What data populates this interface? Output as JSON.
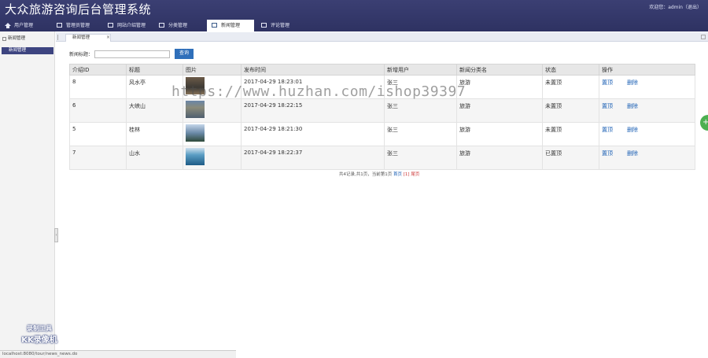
{
  "app": {
    "title": "大众旅游咨询后台管理系统",
    "user_info": "欢迎您：admin（退出）"
  },
  "nav": {
    "tabs": [
      {
        "label": "用户管理"
      },
      {
        "label": "管理员管理"
      },
      {
        "label": "网站介绍管理"
      },
      {
        "label": "分类管理"
      },
      {
        "label": "新闻管理"
      },
      {
        "label": "评论管理"
      }
    ],
    "active_index": 4
  },
  "sidebar": {
    "section_title": "新闻管理",
    "items": [
      {
        "label": "新闻管理"
      }
    ]
  },
  "tabbar": {
    "active_tab": "新闻管理",
    "close_glyph": "×"
  },
  "search": {
    "label": "新闻标题：",
    "value": "",
    "button_label": "查询"
  },
  "table": {
    "headers": [
      "介绍ID",
      "标题",
      "图片",
      "发布时间",
      "新增用户",
      "新闻分类名",
      "状态",
      "操作"
    ],
    "rows": [
      {
        "id": "8",
        "title": "风水亭",
        "time": "2017-04-29 18:23:01",
        "user": "张三",
        "category": "旅游",
        "status": "未置顶",
        "act_top": "置顶",
        "act_del": "删除"
      },
      {
        "id": "6",
        "title": "大峡山",
        "time": "2017-04-29 18:22:15",
        "user": "张三",
        "category": "旅游",
        "status": "未置顶",
        "act_top": "置顶",
        "act_del": "删除"
      },
      {
        "id": "5",
        "title": "桂林",
        "time": "2017-04-29 18:21:30",
        "user": "张三",
        "category": "旅游",
        "status": "未置顶",
        "act_top": "置顶",
        "act_del": "删除"
      },
      {
        "id": "7",
        "title": "山水",
        "time": "2017-04-29 18:22:37",
        "user": "张三",
        "category": "旅游",
        "status": "已置顶",
        "act_top": "置顶",
        "act_del": "删除"
      }
    ]
  },
  "pager": {
    "summary": "共4记录,共1页，当前第1页",
    "home": "首页",
    "current": "[1]",
    "last": "尾页"
  },
  "status_bar": {
    "url": "localhost:8080/tour/news_news.do"
  },
  "watermarks": {
    "url": "https://www.huzhan.com/ishop39397",
    "logo_line1": "录制工具",
    "logo_line2": "KK录像机"
  },
  "float_button": {
    "glyph": "+"
  },
  "collapse_handle": {
    "glyph": "‹"
  },
  "colors": {
    "header": "#3b3f73",
    "accent": "#3d4480",
    "button": "#2f6fba",
    "link": "#1a5fb4"
  }
}
